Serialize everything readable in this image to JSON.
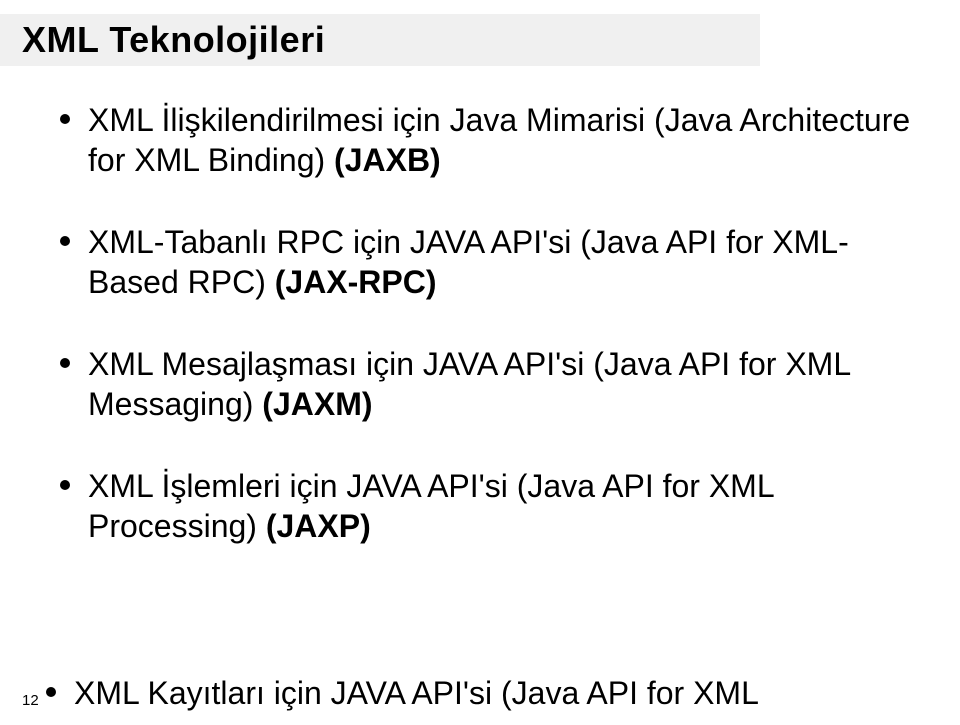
{
  "title": "XML Teknolojileri",
  "bullets": [
    {
      "plain": "XML İlişkilendirilmesi için Java Mimarisi (Java Architecture for XML Binding) ",
      "bold": "(JAXB)"
    },
    {
      "plain": "XML-Tabanlı RPC için JAVA API'si (Java API for XML-Based RPC) ",
      "bold": "(JAX-RPC)"
    },
    {
      "plain": "XML Mesajlaşması için JAVA API'si (Java API for XML Messaging) ",
      "bold": "(JAXM)"
    },
    {
      "plain": "XML İşlemleri için JAVA API'si (Java API for XML Processing) ",
      "bold": "(JAXP)"
    }
  ],
  "lastBullet": {
    "plain": "XML Kayıtları için JAVA API'si (Java API for XML",
    "bold": ""
  },
  "pageNumber": "12"
}
